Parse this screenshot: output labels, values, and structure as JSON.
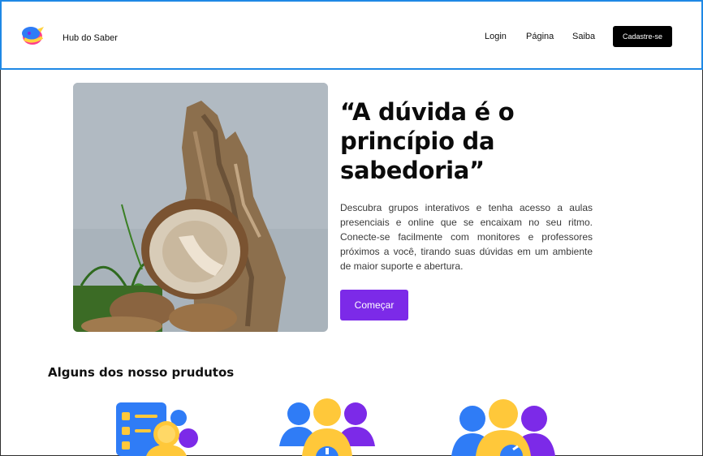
{
  "header": {
    "brand": "Hub do Saber",
    "nav": [
      "Login",
      "Página",
      "Saiba"
    ],
    "cta_label": "Cadastre-se",
    "logo_icon": "hub-logo-icon"
  },
  "hero": {
    "quote": "“A dúvida é o princípio da sabedoria”",
    "description": "Descubra grupos interativos e tenha acesso a aulas presenciais e online que se encaixam no seu ritmo. Conecte-se facilmente com monitores e professores próximos a você, tirando suas dúvidas em um ambiente de maior suporte e abertura.",
    "button_label": "Começar",
    "image": "mushroom-photo"
  },
  "products": {
    "title": "Alguns dos nosso prudutos",
    "items": [
      {
        "icon": "checklist-group-icon"
      },
      {
        "icon": "group-chat-icon"
      },
      {
        "icon": "group-chat-icon"
      }
    ]
  },
  "colors": {
    "header_border": "#1e88e5",
    "primary": "#7c2ae8",
    "cta_bg": "#000000"
  }
}
